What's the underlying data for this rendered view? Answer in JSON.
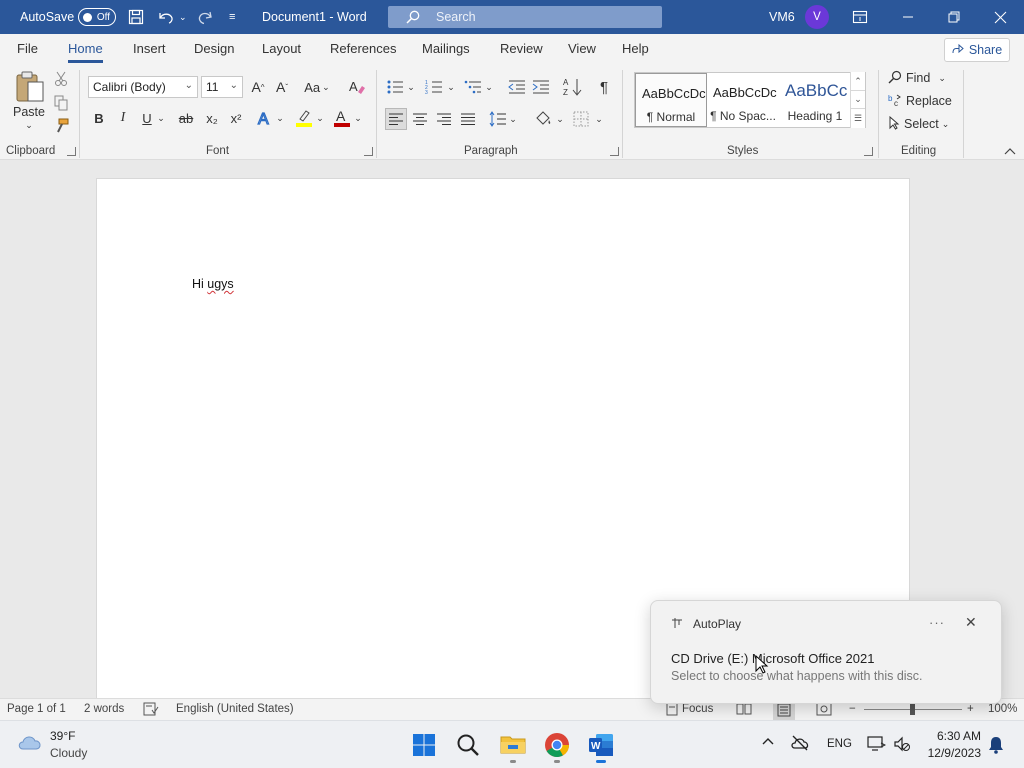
{
  "titlebar": {
    "autosave_label": "AutoSave",
    "autosave_state": "Off",
    "doc_title": "Document1  -  Word",
    "search_placeholder": "Search",
    "user_initials": "VM6",
    "avatar_letter": "V"
  },
  "tabs": [
    "File",
    "Home",
    "Insert",
    "Design",
    "Layout",
    "References",
    "Mailings",
    "Review",
    "View",
    "Help"
  ],
  "active_tab": "Home",
  "share_label": "Share",
  "ribbon": {
    "clipboard": {
      "paste_label": "Paste",
      "group_label": "Clipboard"
    },
    "font": {
      "font_name": "Calibri (Body)",
      "font_size": "11",
      "grow": "A^",
      "shrink": "Aˇ",
      "case": "Aa",
      "bold": "B",
      "italic": "I",
      "underline": "U",
      "strike": "ab",
      "subscript": "x₂",
      "superscript": "x²",
      "group_label": "Font"
    },
    "paragraph": {
      "group_label": "Paragraph"
    },
    "styles": {
      "items": [
        {
          "sample": "AaBbCcDc",
          "name": "¶ Normal"
        },
        {
          "sample": "AaBbCcDc",
          "name": "¶ No Spac..."
        },
        {
          "sample": "AaBbCc",
          "name": "Heading 1"
        }
      ],
      "group_label": "Styles"
    },
    "editing": {
      "find": "Find",
      "replace": "Replace",
      "select": "Select",
      "group_label": "Editing"
    }
  },
  "document": {
    "word1": "Hi ",
    "word2": "ugys"
  },
  "statusbar": {
    "page": "Page 1 of 1",
    "words": "2 words",
    "language": "English (United States)",
    "focus": "Focus",
    "zoom_minus": "−",
    "zoom_plus": "+",
    "zoom": "100%"
  },
  "notification": {
    "app": "AutoPlay",
    "title": "CD Drive (E:) Microsoft Office 2021",
    "body": "Select to choose what happens with this disc.",
    "more": "···",
    "close": "✕"
  },
  "taskbar": {
    "temp": "39°F",
    "weather": "Cloudy",
    "lang": "ENG",
    "time": "6:30 AM",
    "date": "12/9/2023"
  },
  "colors": {
    "title_bar": "#2b579a",
    "accent": "#2b579a",
    "avatar": "#6b38d8",
    "highlight": "#ffff00",
    "font_color": "#c00000"
  }
}
